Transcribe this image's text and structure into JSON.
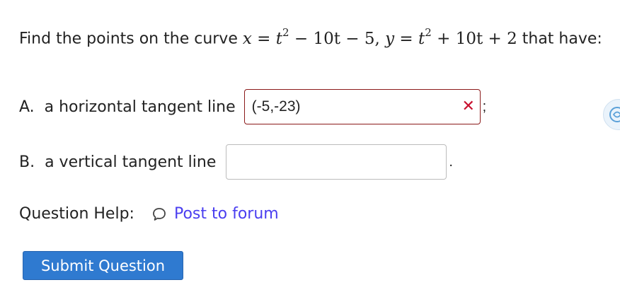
{
  "question": {
    "prompt_before": "Find the points on the curve",
    "prompt_after": "that have:",
    "equation": {
      "x_var": "x",
      "eq": " = ",
      "t": "t",
      "exp": "2",
      "x_rest": " − 10t − 5, ",
      "y_var": "y",
      "y_rest": " + 10t + 2"
    }
  },
  "parts": [
    {
      "label": "A.  a horizontal tangent line",
      "value": "(-5,-23)",
      "status": "incorrect",
      "status_icon": "x-mark-icon",
      "after": ";"
    },
    {
      "label": "B.  a vertical tangent line",
      "value": "",
      "after": "."
    }
  ],
  "help": {
    "label": "Question Help:",
    "link": "Post to forum",
    "icon": "speech-bubble-icon"
  },
  "submit_label": "Submit Question",
  "colors": {
    "link": "#4a3ef0",
    "button": "#2f7ad0",
    "error": "#c8102e",
    "error_border": "#8b1a1a"
  }
}
